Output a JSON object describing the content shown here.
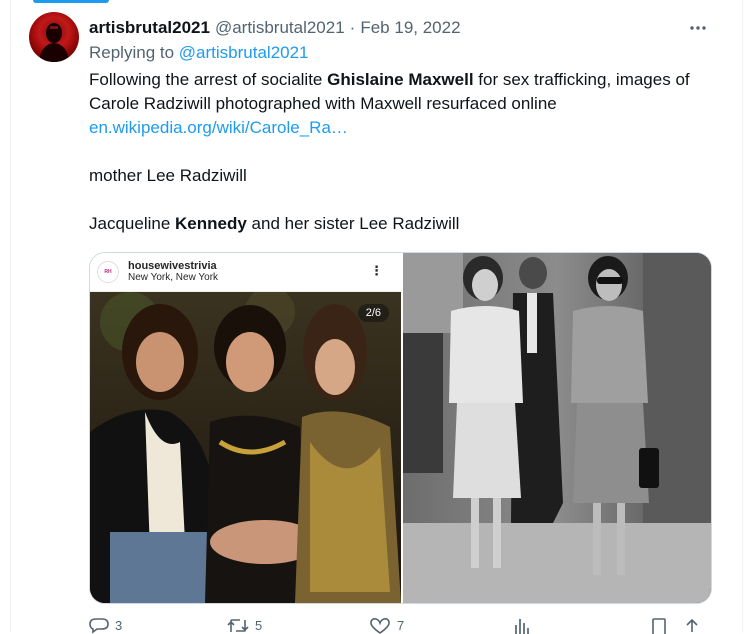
{
  "tweet": {
    "author_name": "artisbrutal2021",
    "handle": "@artisbrutal2021",
    "separator": "·",
    "date": "Feb 19, 2022",
    "replying_prefix": "Replying to",
    "replying_to": "@artisbrutal2021",
    "line1_pre": "Following the arrest of socialite ",
    "line1_bold": "Ghislaine Maxwell",
    "line1_post": " for sex trafficking, images of Carole Radziwill photographed with Maxwell resurfaced online",
    "link": "en.wikipedia.org/wiki/Carole_Ra…",
    "line2": "mother Lee Radziwill",
    "line3_pre": "Jacqueline ",
    "line3_bold": "Kennedy",
    "line3_post": " and her sister Lee Radziwill"
  },
  "media": {
    "left": {
      "account": "housewivestrivia",
      "location": "New York, New York",
      "counter": "2/6",
      "more": "⋮"
    }
  },
  "actions": {
    "reply_count": "3",
    "retweet_count": "5",
    "like_count": "7"
  },
  "colors": {
    "accent": "#1d9bf0",
    "text": "#0f1419",
    "secondary": "#536471",
    "border": "#cfd9de"
  },
  "icons": [
    "more-horizontal-icon",
    "reply-icon",
    "retweet-icon",
    "like-icon",
    "views-icon",
    "bookmark-icon",
    "share-icon"
  ]
}
